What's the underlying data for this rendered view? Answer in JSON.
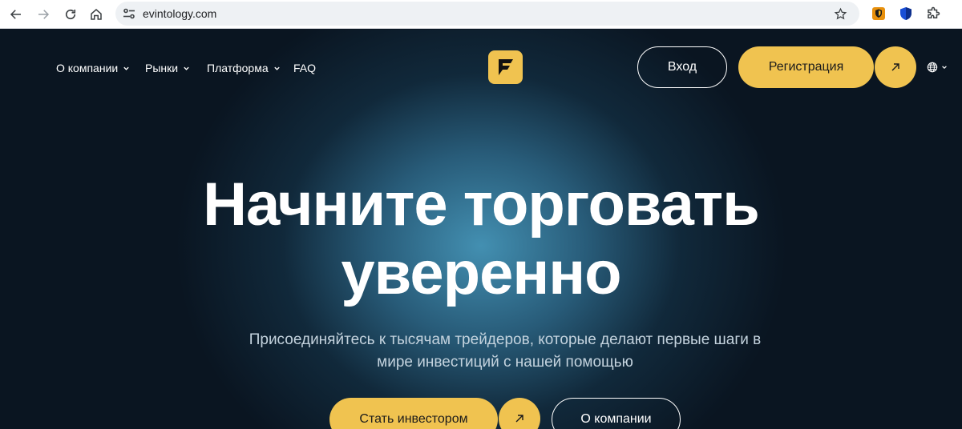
{
  "browser": {
    "url": "evintology.com",
    "back_icon": "arrow-left-icon",
    "forward_icon": "arrow-right-icon",
    "reload_icon": "reload-icon",
    "home_icon": "home-icon",
    "bookmark_icon": "star-icon",
    "extensions": [
      "shield-extension-icon",
      "ublock-icon",
      "puzzle-icon"
    ]
  },
  "nav": {
    "items": [
      {
        "label": "О компании",
        "has_dropdown": true
      },
      {
        "label": "Рынки",
        "has_dropdown": true
      },
      {
        "label": "Платформа",
        "has_dropdown": true
      },
      {
        "label": "FAQ",
        "has_dropdown": false
      }
    ],
    "login_label": "Вход",
    "register_label": "Регистрация",
    "language_icon": "globe-icon"
  },
  "hero": {
    "headline_line1": "Начните торговать",
    "headline_line2": "уверенно",
    "subtitle_line1": "Присоединяйтесь к тысячам трейдеров, которые делают первые шаги в",
    "subtitle_line2": "мире инвестиций с нашей помощью",
    "cta_primary": "Стать инвестором",
    "cta_secondary": "О компании"
  },
  "colors": {
    "accent": "#f0c350",
    "background": "#0a1521",
    "glow": "#4696b9",
    "subtitle": "#c4d3de"
  }
}
